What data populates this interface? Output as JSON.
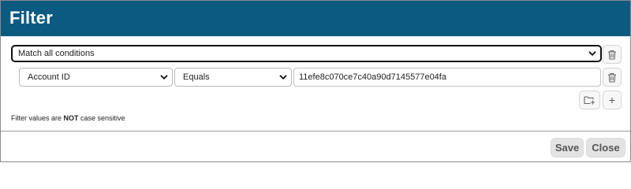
{
  "header": {
    "title": "Filter"
  },
  "match": {
    "selected": "Match all conditions"
  },
  "condition": {
    "field": "Account ID",
    "operator": "Equals",
    "value": "11efe8c070ce7c40a90d7145577e04fa"
  },
  "actions": {
    "add_condition_symbol": "+"
  },
  "note": {
    "prefix": "Filter values are ",
    "emphasis": "NOT",
    "suffix": " case sensitive"
  },
  "footer": {
    "save_label": "Save",
    "close_label": "Close"
  },
  "colors": {
    "header_bg": "#0d5a80",
    "button_bg": "#e3e3e3"
  },
  "icons": {
    "delete": "trash-icon",
    "add_group": "folder-plus-icon",
    "dropdown": "chevron-down-icon"
  }
}
